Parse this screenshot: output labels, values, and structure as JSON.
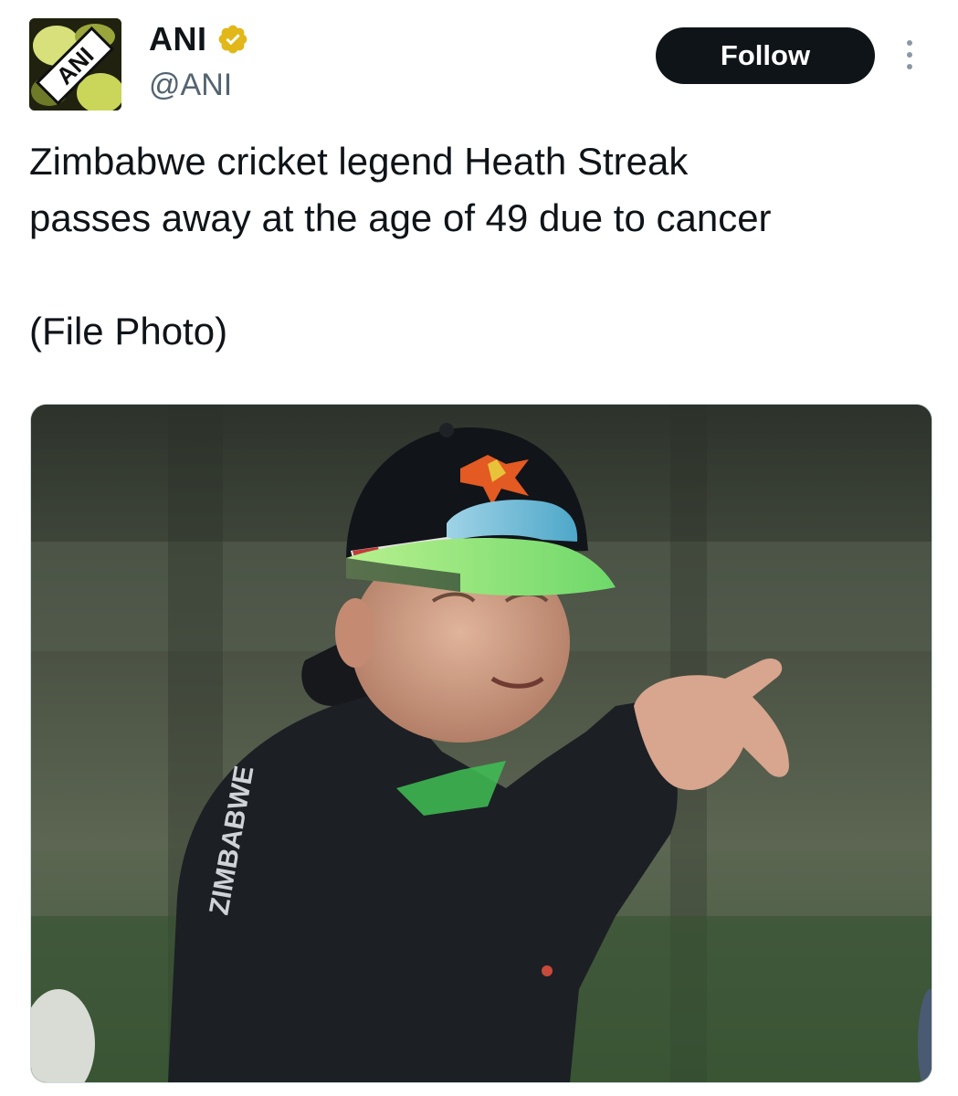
{
  "author": {
    "display_name": "ANI",
    "handle": "@ANI",
    "verified": true,
    "verified_badge_color": "#e2b719",
    "avatar_logo_text": "ANI",
    "avatar_icon": "ani-logo-icon"
  },
  "actions": {
    "follow_label": "Follow",
    "more_icon": "more-options-icon"
  },
  "tweet": {
    "line1": "Zimbabwe cricket legend Heath Streak",
    "line2": "passes away at the age of 49 due to cancer",
    "line3": "(File Photo)"
  },
  "media": {
    "jacket_print": "ZIMBABWE"
  },
  "colors": {
    "follow_bg": "#0f1419",
    "text_primary": "#0f1419",
    "text_secondary": "#536471"
  }
}
